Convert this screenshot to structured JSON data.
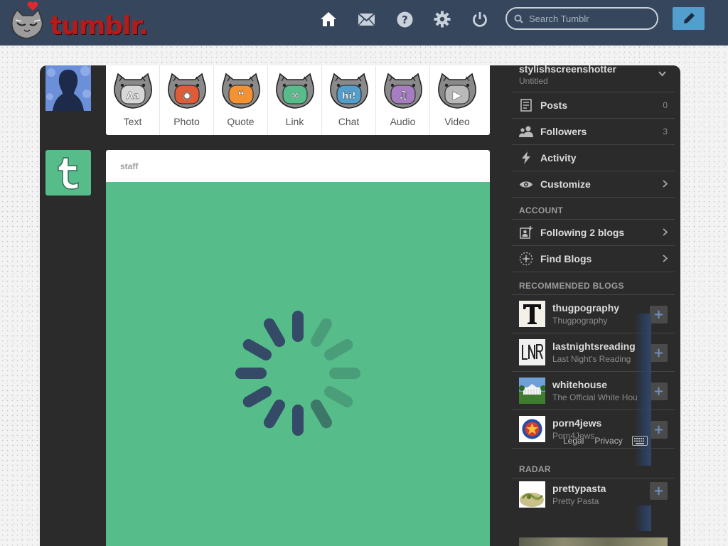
{
  "header": {
    "logo_text": "tumblr.",
    "search_placeholder": "Search Tumblr",
    "nav": [
      "home-icon",
      "mail-icon",
      "help-icon",
      "gear-icon",
      "power-icon"
    ],
    "compose": "pencil-icon"
  },
  "post_types": [
    {
      "label": "Text",
      "color": "#d7d7d7",
      "glyph": "Aa"
    },
    {
      "label": "Photo",
      "color": "#e05b36",
      "glyph": "◉"
    },
    {
      "label": "Quote",
      "color": "#f29232",
      "glyph": "❝"
    },
    {
      "label": "Link",
      "color": "#56bc8a",
      "glyph": "∞"
    },
    {
      "label": "Chat",
      "color": "#529ecc",
      "glyph": "hi!"
    },
    {
      "label": "Audio",
      "color": "#a77dc2",
      "glyph": "♫"
    },
    {
      "label": "Video",
      "color": "#b9b9b9",
      "glyph": "▶"
    }
  ],
  "post": {
    "author": "staff",
    "media_color": "#56bc8a"
  },
  "sidebar": {
    "blog_name": "stylishscreenshotter",
    "blog_title": "Untitled",
    "items": [
      {
        "label": "Posts",
        "count": "0",
        "icon": "posts-icon"
      },
      {
        "label": "Followers",
        "count": "3",
        "icon": "followers-icon"
      },
      {
        "label": "Activity",
        "count": "",
        "icon": "activity-icon"
      },
      {
        "label": "Customize",
        "count": "",
        "icon": "eye-icon"
      }
    ],
    "account_heading": "ACCOUNT",
    "account_items": [
      {
        "label": "Following 2 blogs",
        "icon": "following-icon"
      },
      {
        "label": "Find Blogs",
        "icon": "find-blogs-icon"
      }
    ],
    "recommended_heading": "RECOMMENDED BLOGS",
    "recommended": [
      {
        "name": "thugpography",
        "sub": "Thugpography"
      },
      {
        "name": "lastnightsreading",
        "sub": "Last Night's Reading"
      },
      {
        "name": "whitehouse",
        "sub": "The Official White Hou"
      },
      {
        "name": "porn4jews",
        "sub": "Porn4Jews"
      }
    ],
    "footer_links": [
      "Legal",
      "Privacy"
    ],
    "radar_heading": "RADAR",
    "radar": {
      "name": "prettypasta",
      "sub": "Pretty Pasta"
    }
  }
}
